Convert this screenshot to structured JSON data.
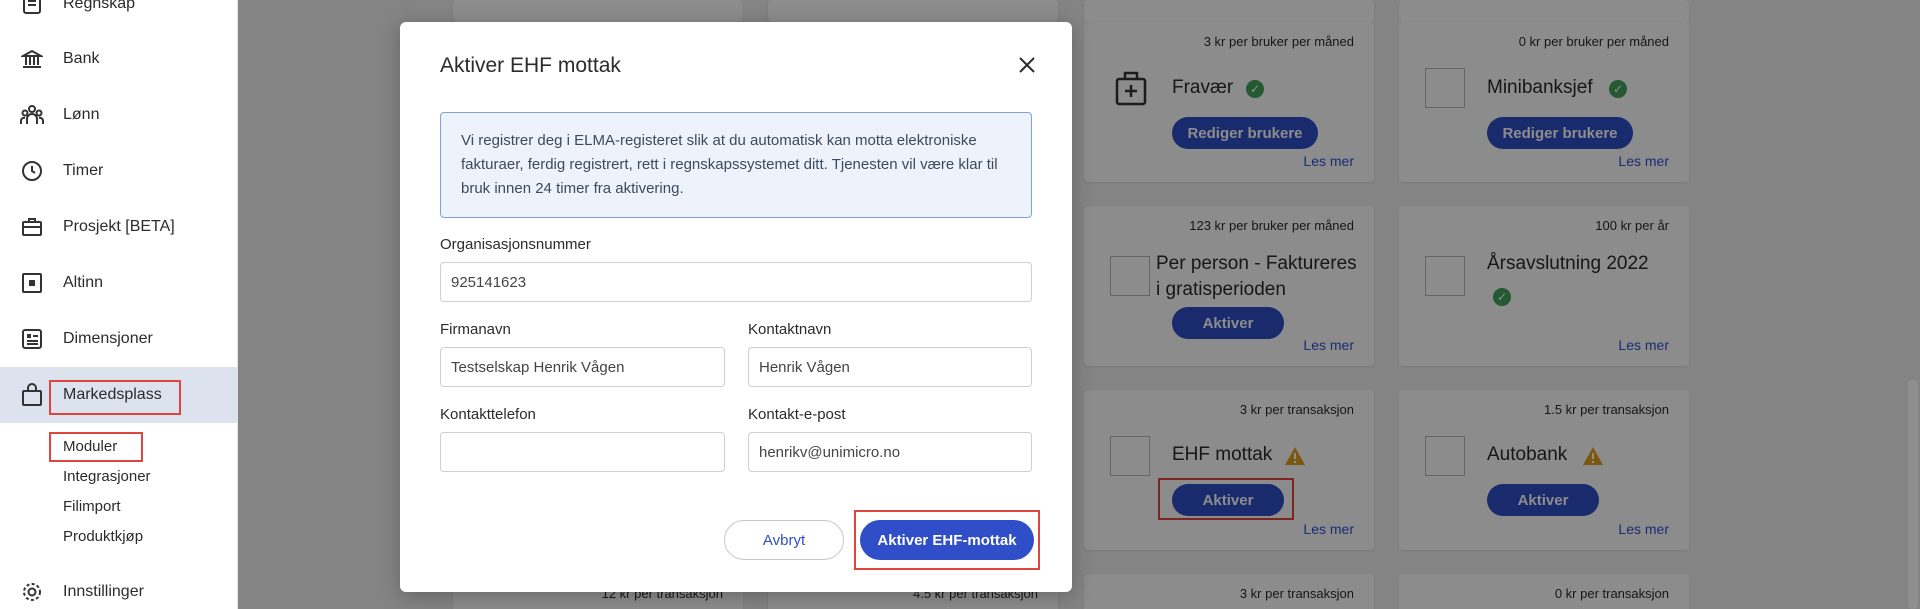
{
  "sidebar": {
    "items": [
      {
        "label": "Regnskap",
        "icon": "ledger-icon"
      },
      {
        "label": "Bank",
        "icon": "bank-icon"
      },
      {
        "label": "Lønn",
        "icon": "people-icon"
      },
      {
        "label": "Timer",
        "icon": "clock-icon"
      },
      {
        "label": "Prosjekt [BETA]",
        "icon": "briefcase-icon"
      },
      {
        "label": "Altinn",
        "icon": "altinn-icon"
      },
      {
        "label": "Dimensjoner",
        "icon": "dimensions-icon"
      },
      {
        "label": "Markedsplass",
        "icon": "bag-icon"
      },
      {
        "label": "Innstillinger",
        "icon": "gear-icon"
      }
    ],
    "subitems": [
      "Moduler",
      "Integrasjoner",
      "Filimport",
      "Produktkjøp"
    ]
  },
  "cards": [
    {
      "price": "3 kr per bruker per måned",
      "title": "Fravær",
      "button": "Rediger brukere",
      "link": "Les mer"
    },
    {
      "price": "0 kr per bruker per måned",
      "title": "Minibanksjef",
      "button": "Rediger brukere",
      "link": "Les mer"
    },
    {
      "price": "123 kr per bruker per måned",
      "title": "Per person - Faktureres i gratisperioden",
      "button": "Aktiver",
      "link": "Les mer"
    },
    {
      "price": "100 kr per år",
      "title": "Årsavslutning 2022",
      "link": "Les mer"
    },
    {
      "price": "3 kr per transaksjon",
      "title": "EHF mottak",
      "button": "Aktiver",
      "link": "Les mer"
    },
    {
      "price": "1.5 kr per transaksjon",
      "title": "Autobank",
      "button": "Aktiver",
      "link": "Les mer"
    },
    {
      "price": "3 kr per transaksjon"
    },
    {
      "price": "0 kr per transaksjon"
    },
    {
      "price": "12 kr per transaksjon"
    },
    {
      "price": "4.5 kr per transaksjon"
    }
  ],
  "modal": {
    "title": "Aktiver EHF mottak",
    "info": "Vi registrer deg i ELMA-registeret slik at du automatisk kan motta elektroniske fakturaer, ferdig registrert, rett i regnskapssystemet ditt. Tjenesten vil være klar til bruk innen 24 timer fra aktivering.",
    "fields": {
      "orgnr_label": "Organisasjonsnummer",
      "orgnr_value": "925141623",
      "firmanavn_label": "Firmanavn",
      "firmanavn_value": "Testselskap Henrik Vågen",
      "kontaktnavn_label": "Kontaktnavn",
      "kontaktnavn_value": "Henrik Vågen",
      "kontakttelefon_label": "Kontakttelefon",
      "kontakttelefon_value": "",
      "kontaktepost_label": "Kontakt-e-post",
      "kontaktepost_value": "henrikv@unimicro.no"
    },
    "cancel_label": "Avbryt",
    "submit_label": "Aktiver EHF-mottak"
  },
  "colors": {
    "primary": "#2f4ec7",
    "highlight": "#e0453d",
    "success": "#43a35a",
    "warning": "#e0a020"
  }
}
